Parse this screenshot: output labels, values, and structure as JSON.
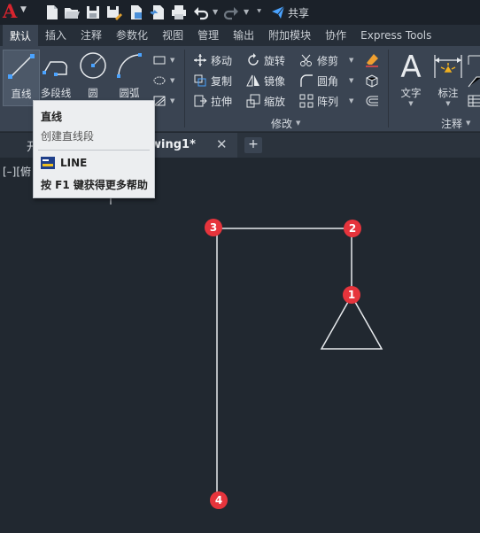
{
  "app": {
    "logo": "A"
  },
  "qat": {
    "share_label": "共享"
  },
  "tabs": [
    {
      "label": "默认",
      "active": true
    },
    {
      "label": "插入"
    },
    {
      "label": "注释"
    },
    {
      "label": "参数化"
    },
    {
      "label": "视图"
    },
    {
      "label": "管理"
    },
    {
      "label": "输出"
    },
    {
      "label": "附加模块"
    },
    {
      "label": "协作"
    },
    {
      "label": "Express Tools"
    }
  ],
  "ribbon": {
    "draw": {
      "line": "直线",
      "polyline": "多段线",
      "circle": "圆",
      "arc": "圆弧"
    },
    "modify": {
      "title": "修改",
      "move": "移动",
      "rotate": "旋转",
      "trim": "修剪",
      "copy": "复制",
      "mirror": "镜像",
      "fillet": "圆角",
      "stretch": "拉伸",
      "scale": "缩放",
      "array": "阵列"
    },
    "annotation": {
      "title": "注释",
      "text": "文字",
      "dimension": "标注"
    }
  },
  "doc_tabs": {
    "start_partial": "开",
    "drawing_partial": "wing1*",
    "close": "✕",
    "new": "+"
  },
  "canvas": {
    "viewport_label": "[–][俯",
    "markers": [
      "1",
      "2",
      "3",
      "4"
    ]
  },
  "tooltip": {
    "title": "直线",
    "description": "创建直线段",
    "command": "LINE",
    "help": "按 F1 键获得更多帮助"
  },
  "colors": {
    "marker": "#e6343c",
    "accent": "#d8242e",
    "background": "#212830"
  }
}
